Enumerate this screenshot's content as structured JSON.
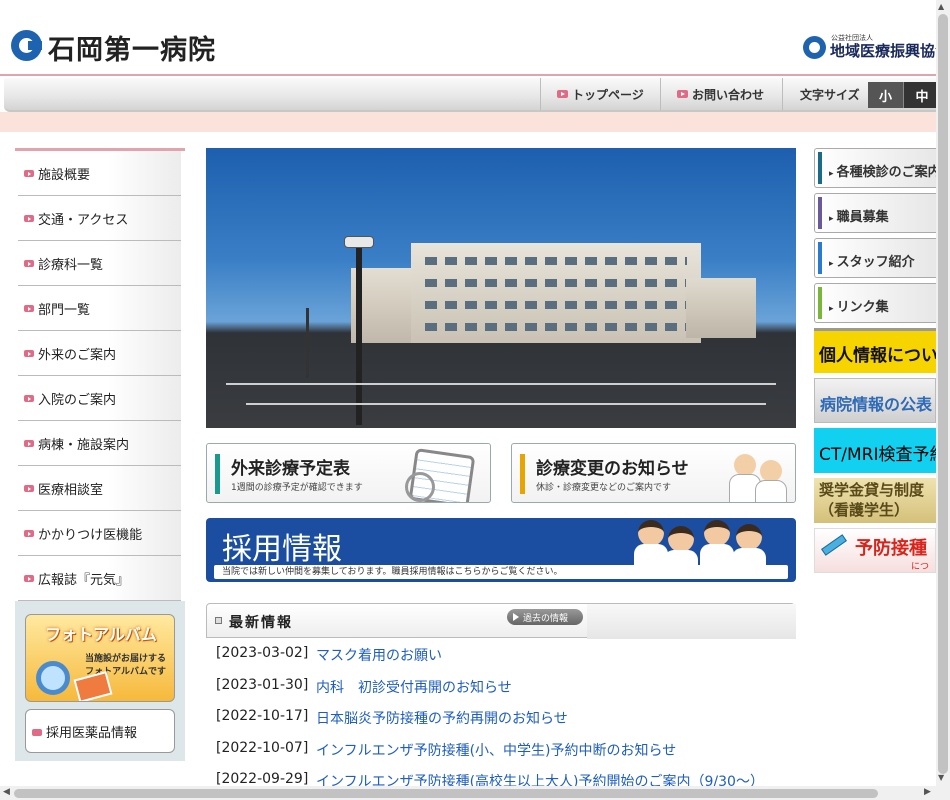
{
  "header": {
    "site_title": "石岡第一病院",
    "org_small": "公益社団法人",
    "org_name": "地域医療振興協会"
  },
  "topnav": {
    "items": [
      {
        "label": "トップページ"
      },
      {
        "label": "お問い合わせ"
      }
    ],
    "font_size_label": "文字サイズ",
    "font_small": "小",
    "font_medium": "中"
  },
  "leftmenu": {
    "items": [
      {
        "label": "施設概要"
      },
      {
        "label": "交通・アクセス"
      },
      {
        "label": "診療科一覧"
      },
      {
        "label": "部門一覧"
      },
      {
        "label": "外来のご案内"
      },
      {
        "label": "入院のご案内"
      },
      {
        "label": "病棟・施設案内"
      },
      {
        "label": "医療相談室"
      },
      {
        "label": "かかりつけ医機能"
      },
      {
        "label": "広報誌『元気』"
      }
    ],
    "photo_album_title": "フォトアルバム",
    "photo_album_sub1": "当施設がお届けする",
    "photo_album_sub2": "フォトアルバムです",
    "drug_info": "採用医薬品情報"
  },
  "main": {
    "banner_schedule": {
      "title": "外来診療予定表",
      "sub": "1週間の診療予定が確認できます",
      "color": "#1a9a8e"
    },
    "banner_change": {
      "title": "診療変更のお知らせ",
      "sub": "休診・診療変更などのご案内です",
      "color": "#e8a400"
    },
    "recruit": {
      "title": "採用情報",
      "sub": "当院では新しい仲間を募集しております。職員採用情報はこちらからご覧ください。"
    },
    "news": {
      "title": "最新情報",
      "archive_label": "過去の情報",
      "items": [
        {
          "date": "[2023-03-02]",
          "text": "マスク着用のお願い"
        },
        {
          "date": "[2023-01-30]",
          "text": "内科　初診受付再開のお知らせ"
        },
        {
          "date": "[2022-10-17]",
          "text": "日本脳炎予防接種の予約再開のお知らせ"
        },
        {
          "date": "[2022-10-07]",
          "text": "インフルエンザ予防接種(小、中学生)予約中断のお知らせ"
        },
        {
          "date": "[2022-09-29]",
          "text": "インフルエンザ予防接種(高校生以上大人)予約開始のご案内（9/30～）"
        }
      ]
    }
  },
  "rightcol": {
    "links": [
      {
        "label": "各種検診のご案内",
        "color": "#1a6a8a"
      },
      {
        "label": "職員募集",
        "color": "#6a5a9a"
      },
      {
        "label": "スタッフ紹介",
        "color": "#2a7ad0"
      },
      {
        "label": "リンク集",
        "color": "#7ab63a"
      }
    ],
    "privacy": "個人情報について",
    "disclosure": "病院情報の公表",
    "ctmri": "CT/MRI検査予約",
    "scholar_line1": "奨学金貸与制度",
    "scholar_line2": "（看護学生）",
    "vaccine": "予防接種",
    "vaccine_small": "につい"
  }
}
